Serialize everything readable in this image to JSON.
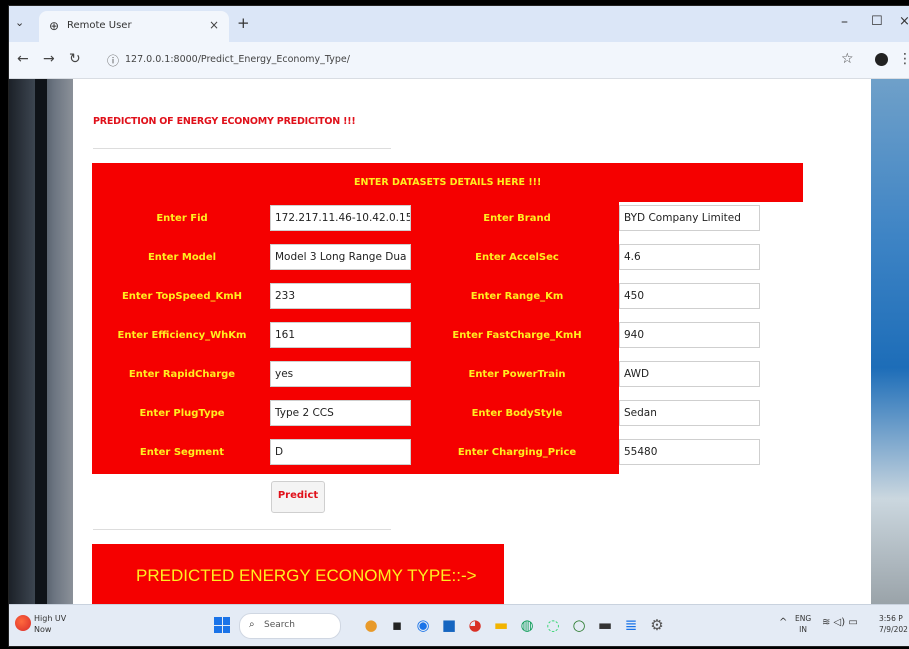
{
  "browser": {
    "tab_title": "Remote User",
    "url": "127.0.0.1:8000/Predict_Energy_Economy_Type/"
  },
  "page": {
    "heading": "PREDICTION OF ENERGY ECONOMY PREDICITON !!!",
    "form_header": "ENTER DATASETS DETAILS HERE !!!",
    "fields": [
      {
        "label": "Enter Fid",
        "value": "172.217.11.46-10.42.0.15"
      },
      {
        "label": "Enter Brand",
        "value": "BYD Company Limited"
      },
      {
        "label": "Enter Model",
        "value": "Model 3 Long Range Dua"
      },
      {
        "label": "Enter AccelSec",
        "value": "4.6"
      },
      {
        "label": "Enter TopSpeed_KmH",
        "value": "233"
      },
      {
        "label": "Enter Range_Km",
        "value": "450"
      },
      {
        "label": "Enter Efficiency_WhKm",
        "value": "161"
      },
      {
        "label": "Enter FastCharge_KmH",
        "value": "940"
      },
      {
        "label": "Enter RapidCharge",
        "value": "yes"
      },
      {
        "label": "Enter PowerTrain",
        "value": "AWD"
      },
      {
        "label": "Enter PlugType",
        "value": "Type 2 CCS"
      },
      {
        "label": "Enter BodyStyle",
        "value": "Sedan"
      },
      {
        "label": "Enter Segment",
        "value": "D"
      },
      {
        "label": "Enter Charging_Price",
        "value": "55480"
      }
    ],
    "predict_button": "Predict",
    "result_label": "PREDICTED ENERGY ECONOMY TYPE::->"
  },
  "taskbar": {
    "weather_title": "High UV",
    "weather_sub": "Now",
    "search_placeholder": "Search",
    "lang_top": "ENG",
    "lang_bottom": "IN",
    "time": "3:56 P",
    "date": "7/9/202"
  },
  "colors": {
    "form_red": "#f50000",
    "label_yellow": "#ffee20",
    "heading_red": "#e0101a"
  }
}
